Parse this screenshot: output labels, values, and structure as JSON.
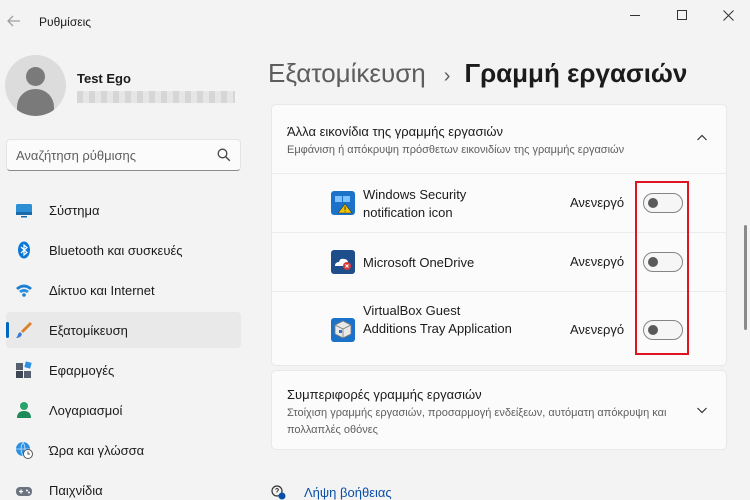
{
  "window": {
    "title": "Ρυθμίσεις"
  },
  "profile": {
    "name": "Test Ego"
  },
  "search": {
    "placeholder": "Αναζήτηση ρύθμισης"
  },
  "nav": {
    "items": [
      {
        "label": "Σύστημα",
        "icon": "system-icon"
      },
      {
        "label": "Bluetooth και συσκευές",
        "icon": "bluetooth-icon"
      },
      {
        "label": "Δίκτυο και Internet",
        "icon": "wifi-icon"
      },
      {
        "label": "Εξατομίκευση",
        "icon": "brush-icon",
        "active": true
      },
      {
        "label": "Εφαρμογές",
        "icon": "apps-icon"
      },
      {
        "label": "Λογαριασμοί",
        "icon": "account-icon"
      },
      {
        "label": "Ώρα και γλώσσα",
        "icon": "globe-clock-icon"
      },
      {
        "label": "Παιχνίδια",
        "icon": "gamepad-icon"
      }
    ]
  },
  "breadcrumb": {
    "parent": "Εξατομίκευση",
    "separator": "›",
    "current": "Γραμμή εργασιών"
  },
  "other_icons": {
    "title": "Άλλα εικονίδια της γραμμής εργασιών",
    "subtitle": "Εμφάνιση ή απόκρυψη πρόσθετων εικονιδίων της γραμμής εργασιών",
    "expanded": true,
    "rows": [
      {
        "name": "Windows Security notification icon",
        "state_label": "Ανενεργό",
        "on": false,
        "icon": "windows-security-icon"
      },
      {
        "name": "Microsoft OneDrive",
        "state_label": "Ανενεργό",
        "on": false,
        "icon": "onedrive-icon"
      },
      {
        "name": "VirtualBox Guest Additions Tray Application",
        "state_label": "Ανενεργό",
        "on": false,
        "icon": "virtualbox-icon"
      }
    ]
  },
  "behaviors": {
    "title": "Συμπεριφορές γραμμής εργασιών",
    "subtitle": "Στοίχιση γραμμής εργασιών, προσαρμογή ενδείξεων, αυτόματη απόκρυψη και πολλαπλές οθόνες",
    "expanded": false
  },
  "help": {
    "label": "Λήψη βοήθειας"
  },
  "colors": {
    "accent": "#0067c0",
    "highlight_box": "#e0141e",
    "link": "#0a4fa8"
  }
}
